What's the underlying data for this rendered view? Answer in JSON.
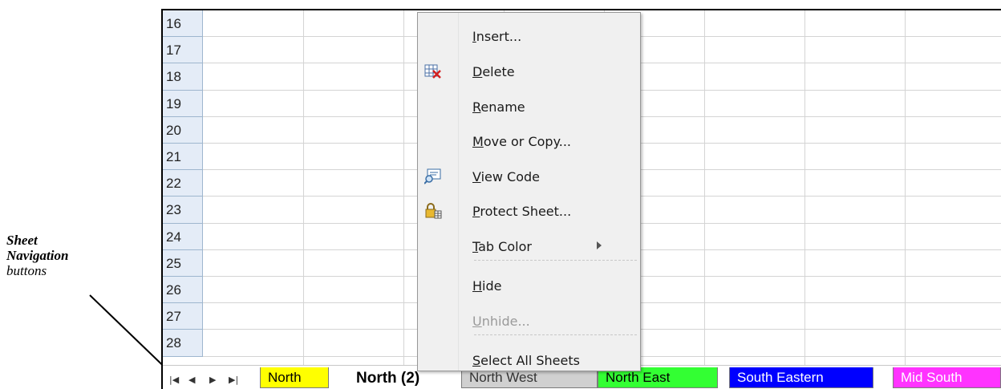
{
  "annotation": {
    "line1": "Sheet",
    "line2": "Navigation",
    "line3": "buttons"
  },
  "rows": [
    "16",
    "17",
    "18",
    "19",
    "20",
    "21",
    "22",
    "23",
    "24",
    "25",
    "26",
    "27",
    "28"
  ],
  "nav_buttons": {
    "first": "⏮",
    "prev": "◀",
    "next": "▶",
    "last": "⏭"
  },
  "tabs": [
    {
      "label": "North",
      "color": "#ffff00"
    },
    {
      "label": "North (2)",
      "color": "#ffffff",
      "active": true
    },
    {
      "label": "North West",
      "color": "#c0c0c0"
    },
    {
      "label": "North East",
      "color": "#33ff33"
    },
    {
      "label": "South Eastern",
      "color": "#0000ff"
    },
    {
      "label": "Mid South",
      "color": "#ff33ff"
    }
  ],
  "menu": {
    "items": [
      {
        "label": "Insert...",
        "hotkey": "I",
        "rest": "nsert...",
        "icon": ""
      },
      {
        "label": "Delete",
        "hotkey": "D",
        "rest": "elete",
        "icon": "delete-sheet-icon"
      },
      {
        "label": "Rename",
        "hotkey": "R",
        "rest": "ename",
        "icon": ""
      },
      {
        "label": "Move or Copy...",
        "hotkey": "M",
        "rest": "ove or Copy...",
        "icon": ""
      },
      {
        "label": "View Code",
        "hotkey": "V",
        "rest": "iew Code",
        "icon": "view-code-icon"
      },
      {
        "label": "Protect Sheet...",
        "hotkey": "P",
        "rest": "rotect Sheet...",
        "icon": "protect-sheet-icon"
      },
      {
        "label": "Tab Color",
        "hotkey": "T",
        "rest": "ab Color",
        "icon": "",
        "submenu": true
      },
      {
        "label": "Hide",
        "hotkey": "H",
        "rest": "ide",
        "icon": ""
      },
      {
        "label": "Unhide...",
        "hotkey": "U",
        "rest": "nhide...",
        "icon": "",
        "disabled": true
      },
      {
        "label": "Select All Sheets",
        "hotkey": "S",
        "rest": "elect All Sheets",
        "icon": ""
      }
    ]
  }
}
